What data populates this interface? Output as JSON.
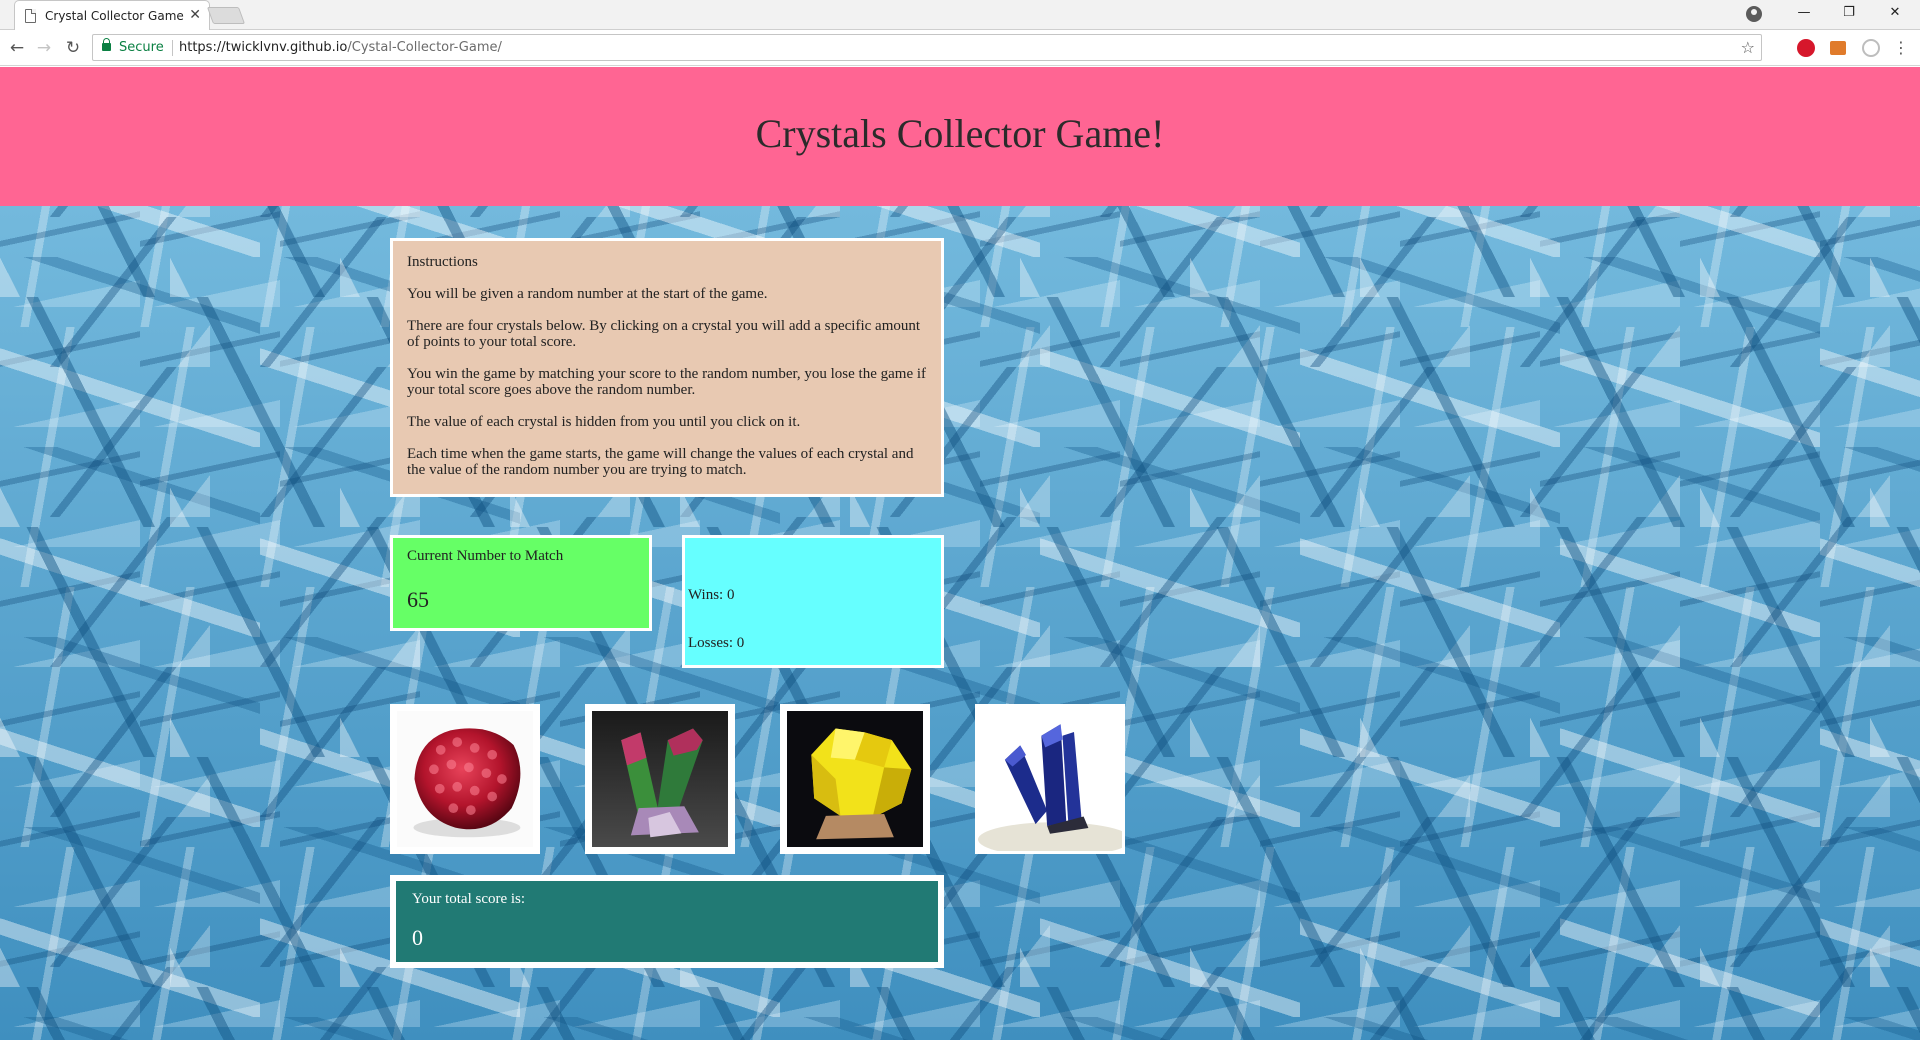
{
  "browser": {
    "tab_title": "Crystal Collector Game",
    "tab_close": "✕",
    "secure_label": "Secure",
    "url_host": "https://twicklvnv.github.io",
    "url_path": "/Cystal-Collector-Game/"
  },
  "page": {
    "title": "Crystals Collector Game!",
    "instructions": {
      "heading": "Instructions",
      "paragraphs": [
        "You will be given a random number at the start of the game.",
        "There are four crystals below. By clicking on a crystal you will add a specific amount of points to your total score.",
        "You win the game by matching your score to the random number, you lose the game if your total score goes above the random number.",
        "The value of each crystal is hidden from you until you click on it.",
        "Each time when the game starts, the game will change the values of each crystal and the value of the random number you are trying to match."
      ]
    },
    "match": {
      "label": "Current Number to Match",
      "value": "65"
    },
    "stats": {
      "wins": "Wins: 0",
      "losses": "Losses: 0"
    },
    "crystals": [
      {
        "name": "red-crystal",
        "color": "#b3142c"
      },
      {
        "name": "green-crystal",
        "color": "#3b8f3b"
      },
      {
        "name": "yellow-crystal",
        "color": "#f2e21a"
      },
      {
        "name": "blue-crystal",
        "color": "#1c2c8c"
      }
    ],
    "score": {
      "label": "Your total score is:",
      "value": "0"
    }
  },
  "colors": {
    "header": "#ff6593",
    "instructions_bg": "#e8c9b2",
    "match_bg": "#66ff66",
    "stats_bg": "#66ffff",
    "score_bg": "#217a74"
  }
}
